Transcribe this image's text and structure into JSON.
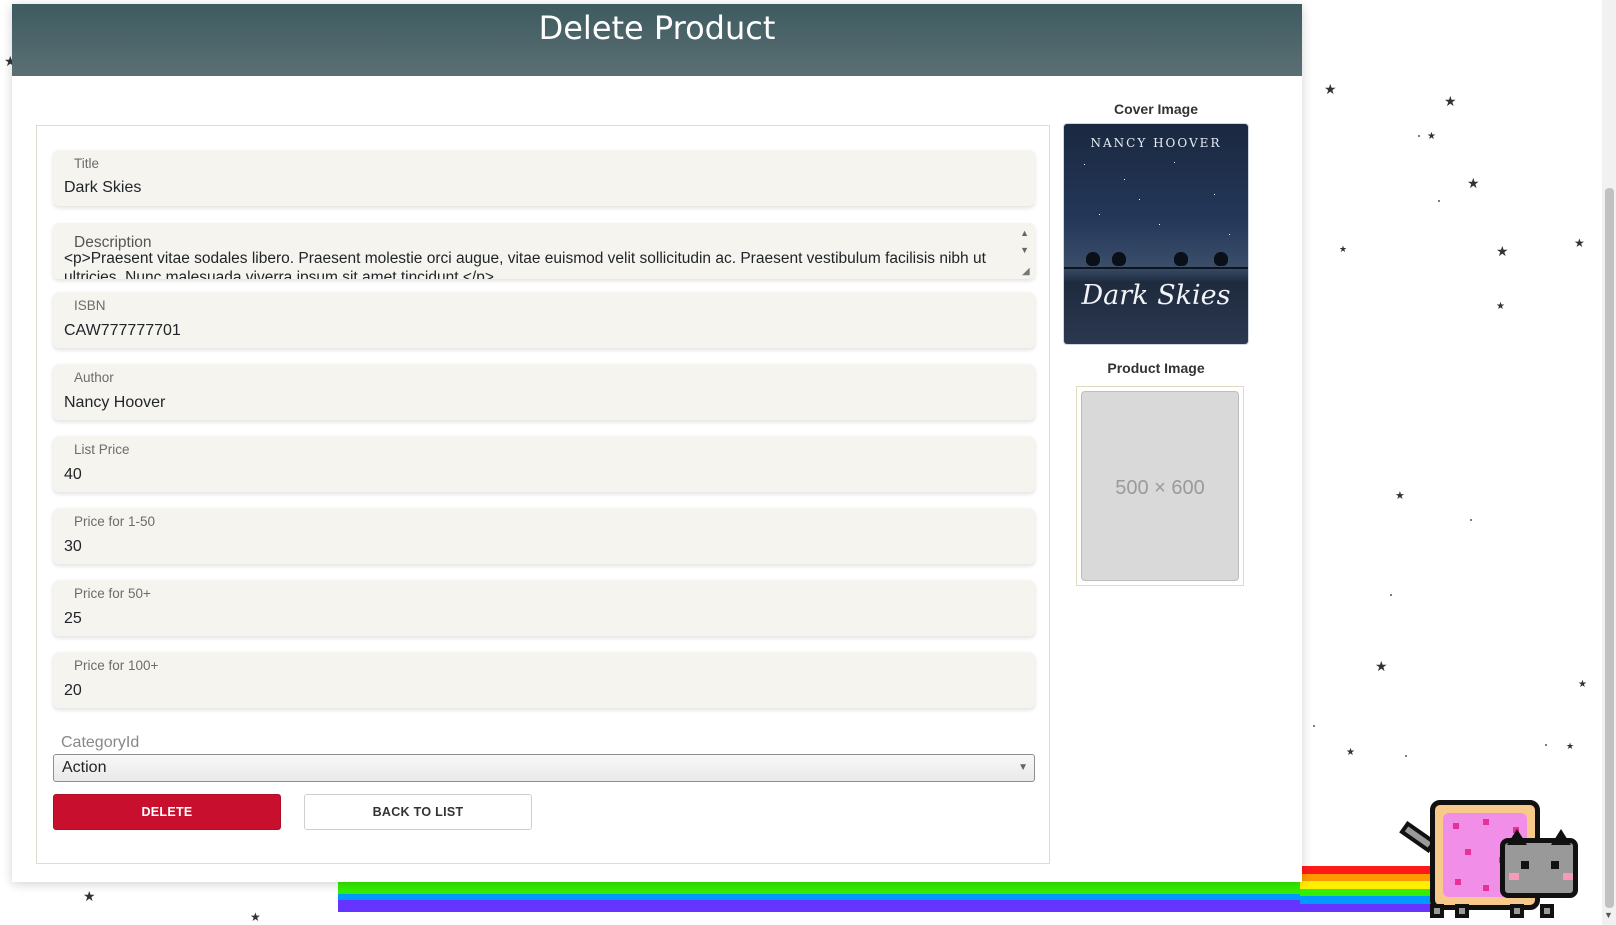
{
  "page": {
    "title": "Delete Product"
  },
  "form": {
    "title": {
      "label": "Title",
      "value": "Dark Skies"
    },
    "description": {
      "label": "Description",
      "value": "<p>Praesent vitae sodales libero. Praesent molestie orci augue, vitae euismod velit sollicitudin ac. Praesent vestibulum facilisis nibh ut ultricies. Nunc malesuada viverra ipsum sit amet tincidunt.</p>"
    },
    "isbn": {
      "label": "ISBN",
      "value": "CAW777777701"
    },
    "author": {
      "label": "Author",
      "value": "Nancy Hoover"
    },
    "list_price": {
      "label": "List Price",
      "value": "40"
    },
    "price_1_50": {
      "label": "Price for 1-50",
      "value": "30"
    },
    "price_50": {
      "label": "Price for 50+",
      "value": "25"
    },
    "price_100": {
      "label": "Price for 100+",
      "value": "20"
    },
    "category": {
      "label": "CategoryId",
      "value": "Action"
    },
    "delete_label": "DELETE",
    "back_label": "BACK TO LIST"
  },
  "side": {
    "cover_title": "Cover Image",
    "cover_author": "NANCY HOOVER",
    "cover_book_title": "Dark Skies",
    "product_title": "Product Image",
    "product_placeholder": "500 × 600"
  },
  "decor": {
    "rainbow_colors": [
      "#ff1a1a",
      "#ff9900",
      "#ffee00",
      "#33ee00",
      "#0099ff",
      "#6633ff"
    ]
  }
}
